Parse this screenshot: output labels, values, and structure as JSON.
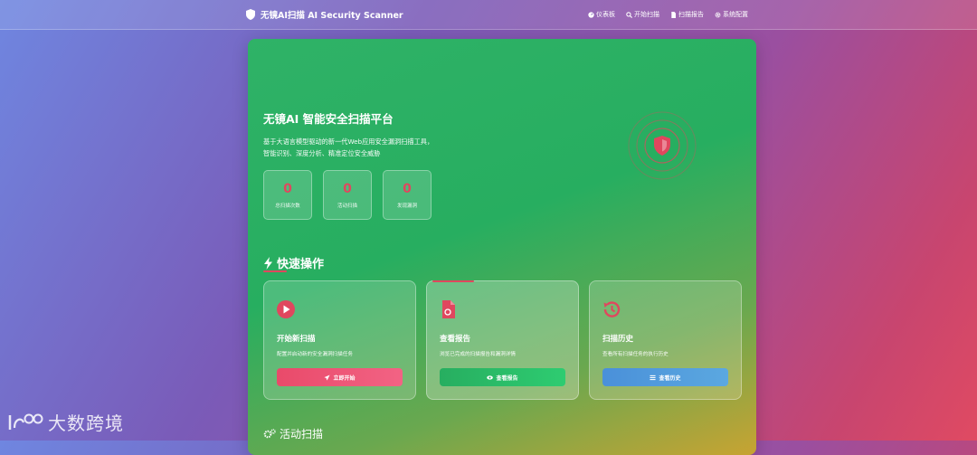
{
  "nav": {
    "brand": "无镜AI扫描 AI Security Scanner",
    "links": [
      {
        "label": "仪表板",
        "icon": "dashboard-icon"
      },
      {
        "label": "开始扫描",
        "icon": "search-icon"
      },
      {
        "label": "扫描报告",
        "icon": "document-icon"
      },
      {
        "label": "系统配置",
        "icon": "gear-icon"
      }
    ]
  },
  "hero": {
    "title": "无镜AI 智能安全扫描平台",
    "desc_line1": "基于大语言模型驱动的新一代Web应用安全漏洞扫描工具，",
    "desc_line2": "智能识别、深度分析、精准定位安全威胁",
    "stats": [
      {
        "value": "0",
        "label": "总扫描次数"
      },
      {
        "value": "0",
        "label": "活动扫描"
      },
      {
        "value": "0",
        "label": "发现漏洞"
      }
    ]
  },
  "quick": {
    "title": "快速操作",
    "cards": [
      {
        "icon": "play-circle-icon",
        "title": "开始新扫描",
        "desc": "配置并启动新的安全漏洞扫描任务",
        "button": "立即开始",
        "button_icon": "rocket-icon"
      },
      {
        "icon": "report-file-icon",
        "title": "查看报告",
        "desc": "浏览已完成的扫描报告和漏洞详情",
        "button": "查看报告",
        "button_icon": "eye-icon"
      },
      {
        "icon": "history-icon",
        "title": "扫描历史",
        "desc": "查看所有扫描任务的执行历史",
        "button": "查看历史",
        "button_icon": "list-icon"
      }
    ]
  },
  "active_scans": {
    "title": "活动扫描"
  },
  "watermark": "大数跨境",
  "colors": {
    "accent": "#e0475e",
    "green": "#27ae60",
    "blue": "#4a90d9"
  }
}
